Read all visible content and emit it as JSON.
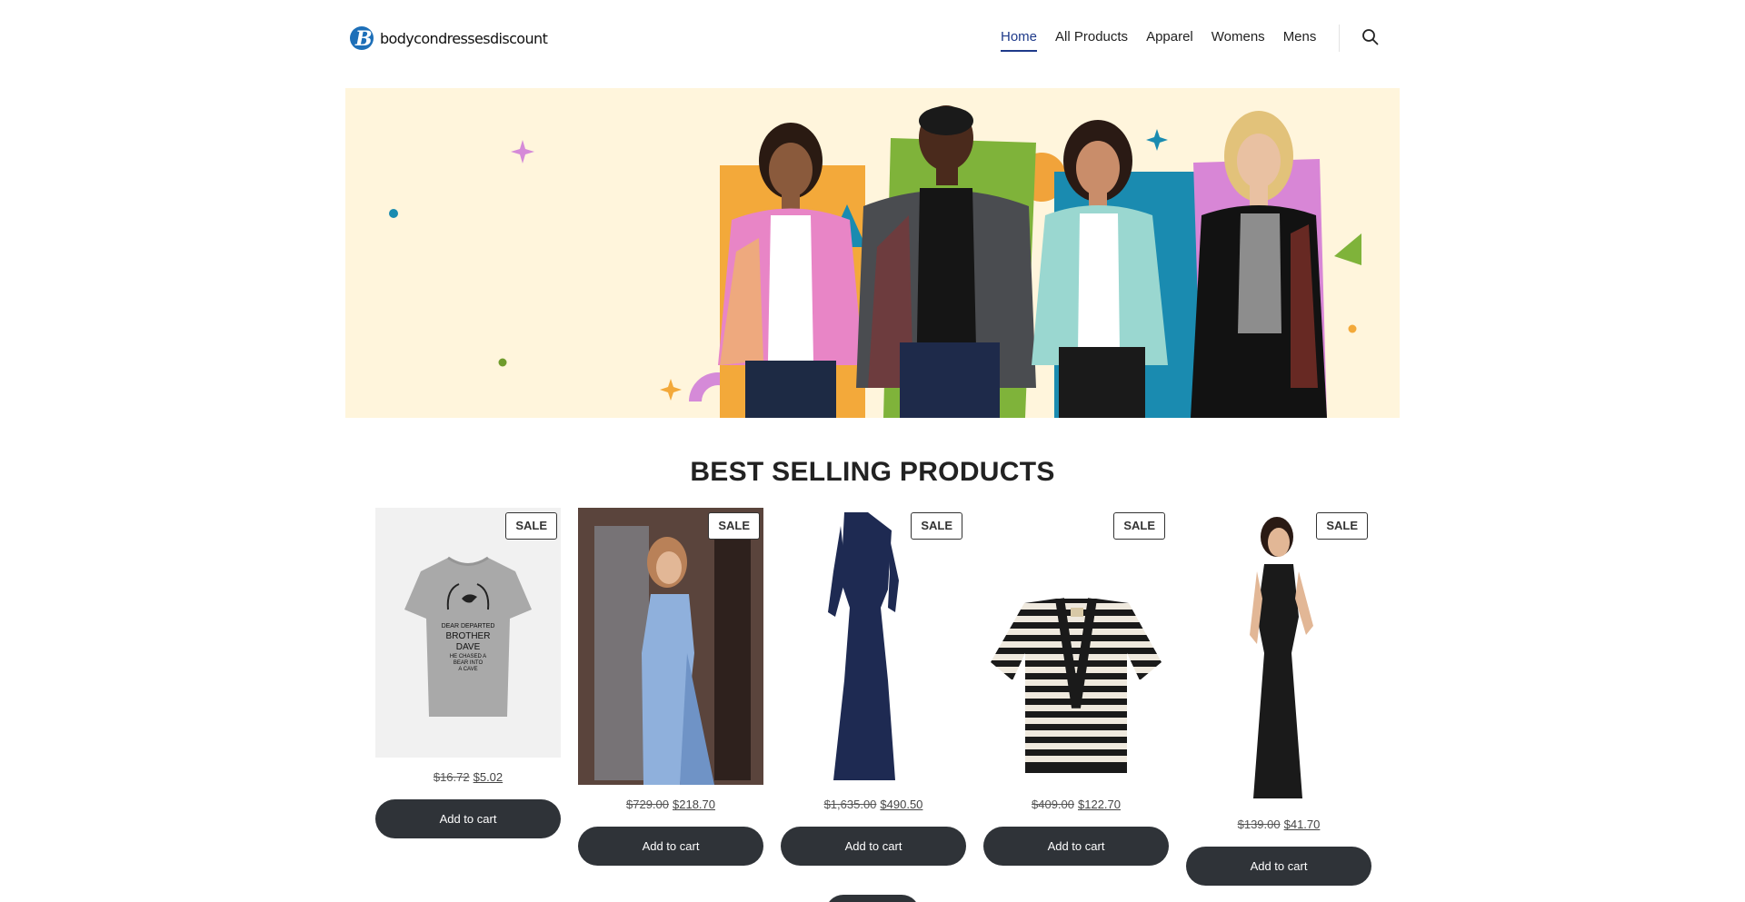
{
  "header": {
    "logo_text": "bodycondressesdiscount",
    "nav": [
      "Home",
      "All Products",
      "Apparel",
      "Womens",
      "Mens"
    ],
    "active_nav": "Home",
    "search_icon": "search-icon"
  },
  "section": {
    "title": "BEST SELLING PRODUCTS"
  },
  "products": [
    {
      "badge": "SALE",
      "old_price": "$16.72",
      "new_price": "$5.02",
      "button": "Add to cart",
      "tee_line1": "DEAR DEPARTED",
      "tee_line2": "BROTHER",
      "tee_line3": "DAVE",
      "tee_line4": "HE CHASED A",
      "tee_line5": "BEAR INTO",
      "tee_line6": "A CAVE"
    },
    {
      "badge": "SALE",
      "old_price": "$729.00",
      "new_price": "$218.70",
      "button": "Add to cart"
    },
    {
      "badge": "SALE",
      "old_price": "$1,635.00",
      "new_price": "$490.50",
      "button": "Add to cart"
    },
    {
      "badge": "SALE",
      "old_price": "$409.00",
      "new_price": "$122.70",
      "button": "Add to cart"
    },
    {
      "badge": "SALE",
      "old_price": "$139.00",
      "new_price": "$41.70",
      "button": "Add to cart"
    }
  ],
  "colors": {
    "accent": "#1e3a8a",
    "button": "#2f3338",
    "hero_bg": "#fff5dc"
  }
}
